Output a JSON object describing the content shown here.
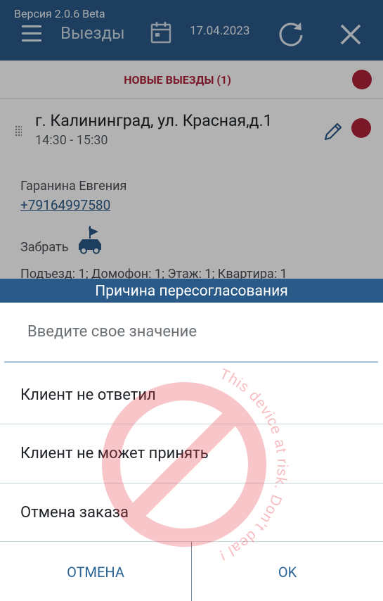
{
  "header": {
    "version": "Версия 2.0.6 Beta",
    "title": "Выезды",
    "date": "17.04.2023"
  },
  "section": {
    "title": "НОВЫЕ ВЫЕЗДЫ (1)"
  },
  "order": {
    "address": "г. Калининград, ул. Красная,д.1",
    "time": "14:30 - 15:30",
    "client_name": "Гаранина Евгения",
    "phone": "+79164997580",
    "pickup_label": "Забрать",
    "details": "Подъезд: 1; Домофон: 1; Этаж: 1; Квартира: 1"
  },
  "dialog": {
    "title": "Причина пересогласования",
    "input_placeholder": "Введите свое значение",
    "options": [
      {
        "label": "Клиент не ответил"
      },
      {
        "label": "Клиент не может принять"
      },
      {
        "label": "Отмена заказа"
      }
    ],
    "cancel_label": "ОТМЕНА",
    "ok_label": "OK"
  },
  "watermark": {
    "text": "This device at risk. Don't deal !"
  },
  "colors": {
    "header_bg": "#2a5a88",
    "accent_red": "#b0233a",
    "link_blue": "#2a6496",
    "watermark_red": "#e8333d"
  },
  "icons": {
    "menu": "hamburger-icon",
    "calendar": "calendar-icon",
    "refresh": "refresh-icon",
    "close": "close-icon",
    "edit": "pencil-icon",
    "pickup": "car-with-flag-icon",
    "drag": "drag-handle-icon"
  }
}
